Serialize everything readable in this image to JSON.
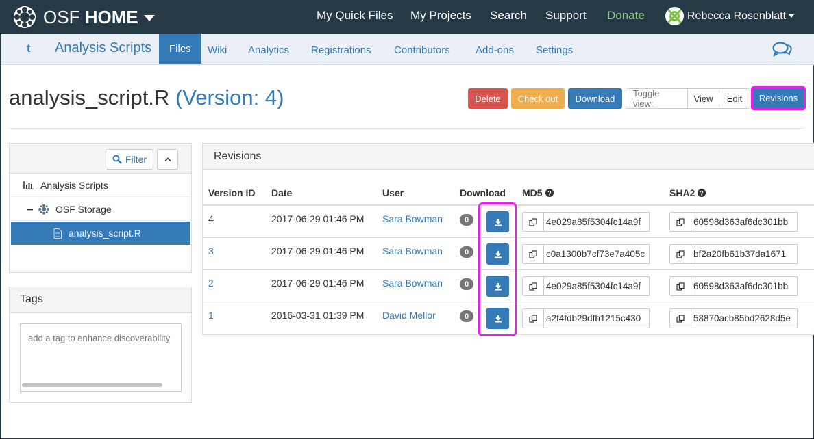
{
  "topbar": {
    "brand_light": "OSF",
    "brand_bold": "HOME",
    "links": [
      "My Quick Files",
      "My Projects",
      "Search",
      "Support",
      "Donate"
    ],
    "user_name": "Rebecca Rosenblatt"
  },
  "project_nav": {
    "home_glyph": "t",
    "title": "Analysis Scripts",
    "tabs": [
      "Files",
      "Wiki",
      "Analytics",
      "Registrations",
      "Contributors",
      "Add-ons",
      "Settings"
    ],
    "active_tab": "Files"
  },
  "file": {
    "name": "analysis_script.R",
    "version_label": "(Version: 4)"
  },
  "actions": {
    "delete": "Delete",
    "checkout": "Check out",
    "download": "Download",
    "toggle_label": "Toggle view:",
    "view": "View",
    "edit": "Edit",
    "revisions": "Revisions"
  },
  "tree": {
    "filter": "Filter",
    "items": [
      "Analysis Scripts",
      "OSF Storage",
      "analysis_script.R"
    ],
    "selected": "analysis_script.R"
  },
  "tags": {
    "title": "Tags",
    "placeholder": "add a tag to enhance discoverability"
  },
  "revisions": {
    "title": "Revisions",
    "columns": [
      "Version ID",
      "Date",
      "User",
      "Download",
      "MD5",
      "SHA2"
    ],
    "rows": [
      {
        "version": "4",
        "date": "2017-06-29 01:46 PM",
        "user": "Sara Bowman",
        "downloads": "0",
        "md5": "4e029a85f5304fc14a9f",
        "sha2": "60598d363af6dc301bb"
      },
      {
        "version": "3",
        "date": "2017-06-29 01:46 PM",
        "user": "Sara Bowman",
        "downloads": "0",
        "md5": "c0a1300b7cf73e7a405c",
        "sha2": "bf2a20fb61b37da1671"
      },
      {
        "version": "2",
        "date": "2017-06-29 01:46 PM",
        "user": "Sara Bowman",
        "downloads": "0",
        "md5": "4e029a85f5304fc14a9f",
        "sha2": "60598d363af6dc301bb"
      },
      {
        "version": "1",
        "date": "2016-03-31 01:39 PM",
        "user": "David Mellor",
        "downloads": "0",
        "md5": "a2f4fdb29dfb1215c430",
        "sha2": "58870acb85bd2628d5e"
      }
    ]
  },
  "colors": {
    "navbar": "#263947",
    "primary": "#337ab7",
    "danger": "#d9534f",
    "warning": "#f0ad4e",
    "donate": "#8ec882",
    "highlight": "#e620e6"
  }
}
